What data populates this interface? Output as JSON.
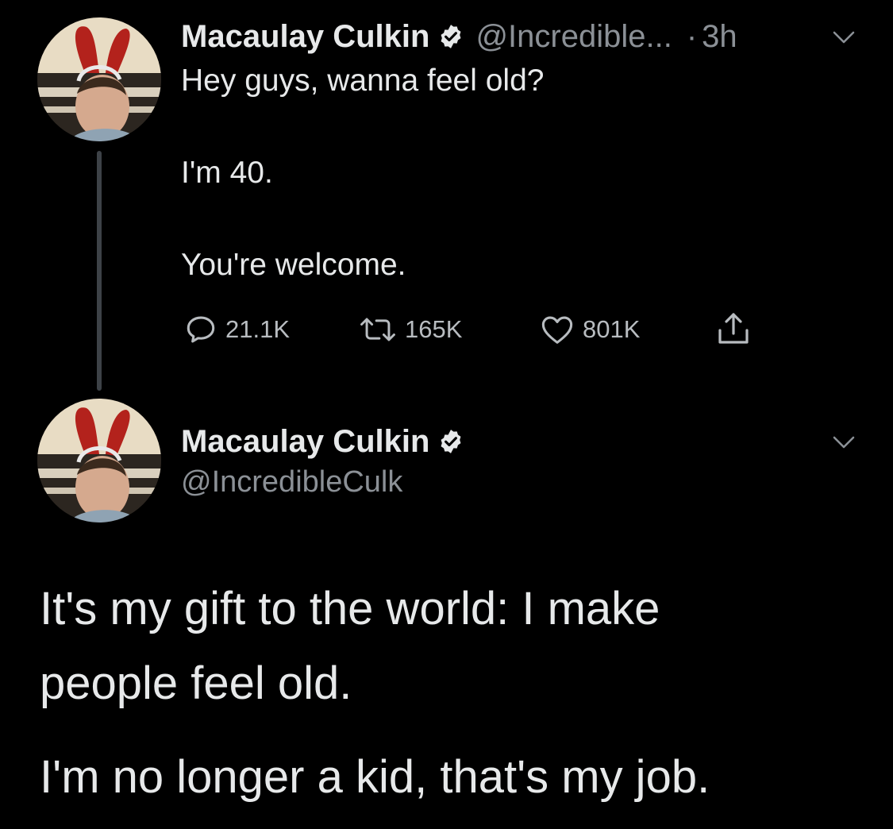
{
  "tweet": {
    "author": {
      "display_name": "Macaulay Culkin",
      "handle_truncated": "@Incredible...",
      "verified": true
    },
    "time_separator": "·",
    "time": "3h",
    "lines": [
      "Hey guys, wanna feel old?",
      "I'm 40.",
      "You're welcome."
    ],
    "actions": {
      "reply_count": "21.1K",
      "retweet_count": "165K",
      "like_count": "801K"
    }
  },
  "reply": {
    "author": {
      "display_name": "Macaulay Culkin",
      "handle": "@IncredibleCulk",
      "verified": true
    },
    "lines": [
      "It's my gift to the world: I make",
      "people feel old.",
      "I'm no longer a kid, that's my job."
    ]
  },
  "colors": {
    "background": "#000000",
    "text": "#e7e9ea",
    "secondary": "#8b9096",
    "thread_line": "#3d4247"
  },
  "icons": [
    "reply-icon",
    "retweet-icon",
    "like-icon",
    "share-icon",
    "verified-badge-icon",
    "chevron-down-icon"
  ]
}
